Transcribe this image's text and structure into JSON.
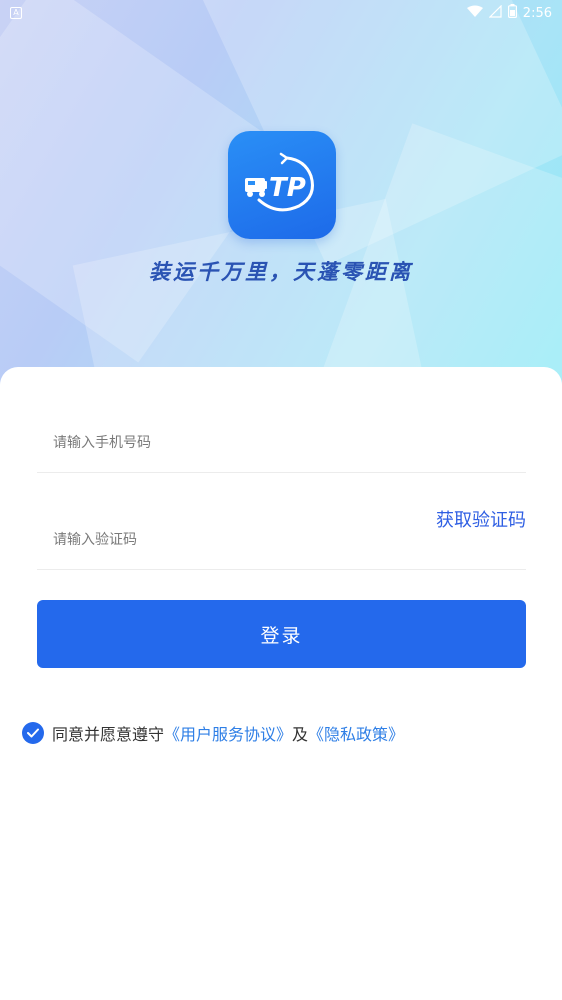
{
  "status_bar": {
    "notification_glyph": "A",
    "time": "2:56",
    "icons": [
      "wifi-icon",
      "signal-icon",
      "battery-icon"
    ]
  },
  "header": {
    "logo_text": "TP",
    "slogan": "装运千万里，天蓬零距离"
  },
  "form": {
    "phone_placeholder": "请输入手机号码",
    "code_placeholder": "请输入验证码",
    "get_code_label": "获取验证码",
    "login_label": "登录"
  },
  "agreement": {
    "checked": true,
    "prefix": "同意并愿意遵守",
    "user_agreement": "《用户服务协议》",
    "connector": "及",
    "privacy_policy": "《隐私政策》"
  },
  "colors": {
    "accent": "#2469ec",
    "link": "#2f7fe6",
    "slogan": "#2a53b3"
  }
}
